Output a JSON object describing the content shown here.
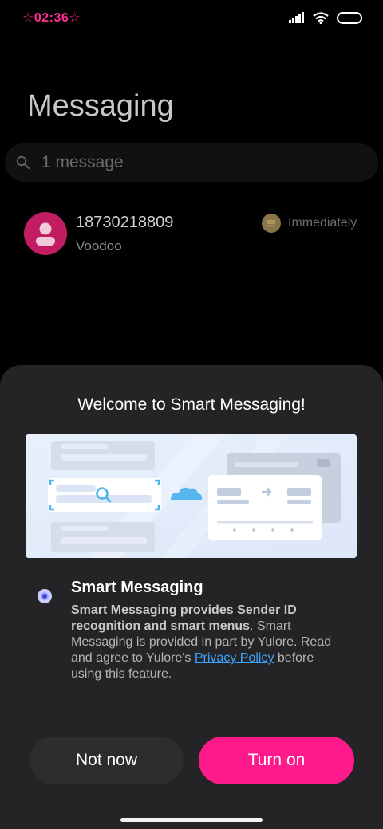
{
  "status_bar": {
    "time": "☆02:36☆",
    "icons": [
      "signal-icon",
      "wifi-icon",
      "battery-icon"
    ]
  },
  "app": {
    "title": "Messaging",
    "search": {
      "text": "1 message",
      "icon": "search-icon"
    }
  },
  "conversations": [
    {
      "sender": "18730218809",
      "preview": "Voodoo",
      "time": "Immediately",
      "avatar_icon": "person-icon",
      "badge_icon": "menu-badge-icon"
    }
  ],
  "sheet": {
    "title": "Welcome to Smart Messaging!",
    "option": {
      "title": "Smart Messaging",
      "desc_bold": "Smart Messaging provides Sender ID recognition and smart menus",
      "desc_part1": ". Smart Messaging is provided in part by Yulore. Read and agree to Yulore's ",
      "link": "Privacy Policy",
      "desc_part2": " before using this feature.",
      "selected": true
    },
    "buttons": {
      "secondary": "Not now",
      "primary": "Turn on"
    }
  },
  "colors": {
    "accent": "#ff1a8c",
    "avatar": "#c21c63",
    "link": "#3ea3ff",
    "sheet_bg": "#242426"
  }
}
